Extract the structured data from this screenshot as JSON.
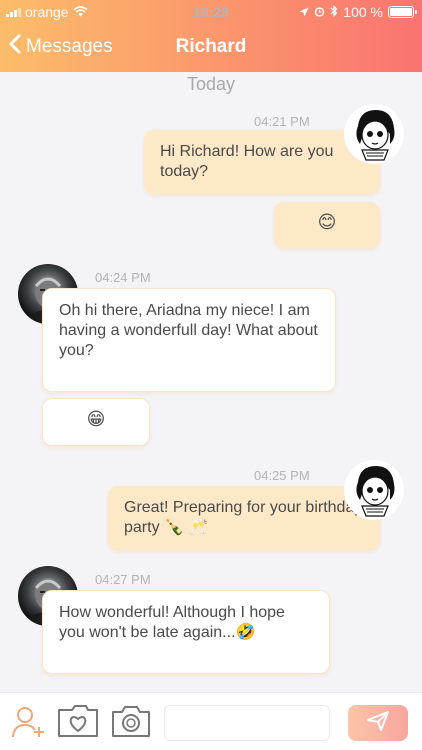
{
  "status_bar": {
    "carrier": "orange",
    "time": "16:28",
    "battery": "100 %"
  },
  "nav": {
    "back_label": "Messages",
    "title": "Richard"
  },
  "chat": {
    "day_label": "Today",
    "messages": [
      {
        "time": "04:21 PM",
        "text": "Hi Richard! How are you today?",
        "sender": "me"
      },
      {
        "text": "😊",
        "sender": "me"
      },
      {
        "time": "04:24 PM",
        "text": "Oh hi there, Ariadna my niece! I am having a wonderfull day! What about you?",
        "sender": "Richard"
      },
      {
        "text": "😁",
        "sender": "Richard"
      },
      {
        "time": "04:25 PM",
        "text": "Great! Preparing for your birthday party 🍾 🥂",
        "sender": "me"
      },
      {
        "time": "04:27 PM",
        "text": "How wonderful! Although I hope you won't be late again...🤣",
        "sender": "Richard"
      }
    ]
  },
  "composer": {
    "value": "",
    "placeholder": ""
  },
  "colors": {
    "accent": "#f97470",
    "header_start": "#fbbd6a",
    "bubble_out": "#fde8c7",
    "bubble_in_border": "#fbe3c7"
  },
  "icons": [
    "add-contact-icon",
    "favorites-folder-icon",
    "camera-icon",
    "send-icon"
  ]
}
